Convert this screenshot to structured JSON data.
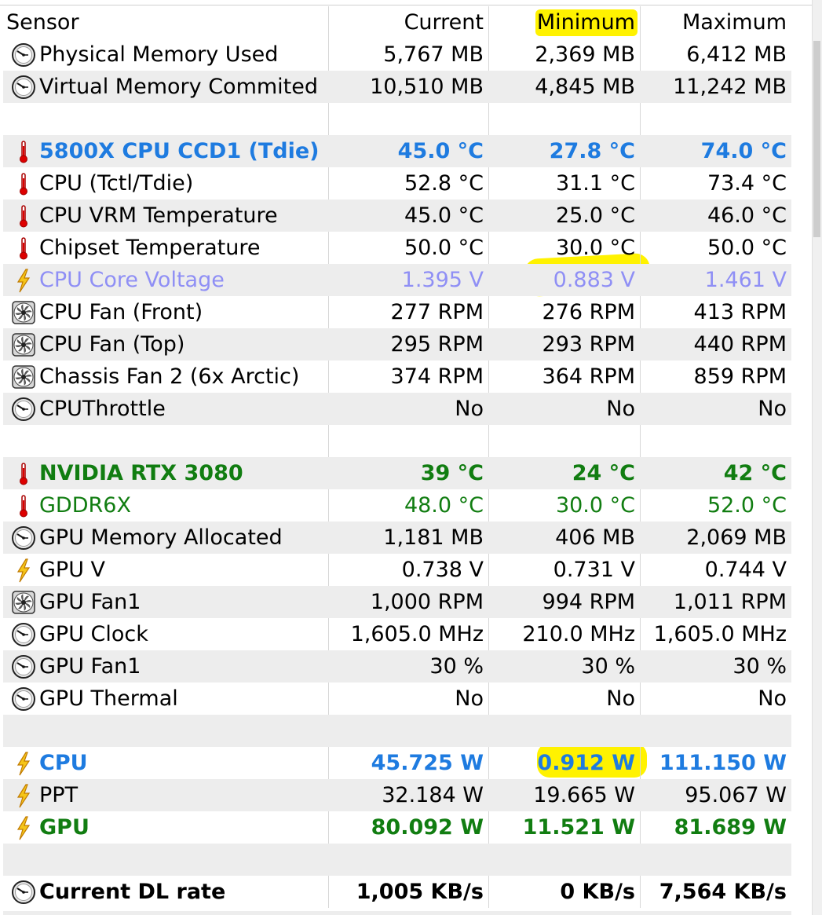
{
  "header": {
    "sensor": "Sensor",
    "current": "Current",
    "minimum": "Minimum",
    "maximum": "Maximum"
  },
  "colors": {
    "blue": "#1e7be0",
    "green": "#117d11",
    "faded": "#8f8ff5",
    "highlight": "#fff200"
  },
  "rows": [
    {
      "name": "Physical Memory Used",
      "cur": "5,767 MB",
      "min": "2,369 MB",
      "max": "6,412 MB",
      "icon": "clock-gauge-icon"
    },
    {
      "name": "Virtual Memory Commited",
      "cur": "10,510 MB",
      "min": "4,845 MB",
      "max": "11,242 MB",
      "icon": "clock-gauge-icon"
    },
    {
      "name": "",
      "cur": "",
      "min": "",
      "max": "",
      "icon": ""
    },
    {
      "name": "5800X CPU CCD1 (Tdie)",
      "cur": "45.0 °C",
      "min": "27.8 °C",
      "max": "74.0 °C",
      "icon": "thermometer-icon"
    },
    {
      "name": "CPU (Tctl/Tdie)",
      "cur": "52.8 °C",
      "min": "31.1 °C",
      "max": "73.4 °C",
      "icon": "thermometer-icon"
    },
    {
      "name": "CPU VRM Temperature",
      "cur": "45.0 °C",
      "min": "25.0 °C",
      "max": "46.0 °C",
      "icon": "thermometer-icon"
    },
    {
      "name": "Chipset Temperature",
      "cur": "50.0 °C",
      "min": "30.0 °C",
      "max": "50.0 °C",
      "icon": "thermometer-icon"
    },
    {
      "name": "CPU Core Voltage",
      "cur": "1.395 V",
      "min": "0.883 V",
      "max": "1.461 V",
      "icon": "lightning-icon"
    },
    {
      "name": "CPU Fan (Front)",
      "cur": "277 RPM",
      "min": "276 RPM",
      "max": "413 RPM",
      "icon": "fan-icon"
    },
    {
      "name": "CPU Fan (Top)",
      "cur": "295 RPM",
      "min": "293 RPM",
      "max": "440 RPM",
      "icon": "fan-icon"
    },
    {
      "name": "Chassis Fan 2 (6x Arctic)",
      "cur": "374 RPM",
      "min": "364 RPM",
      "max": "859 RPM",
      "icon": "fan-icon"
    },
    {
      "name": "CPUThrottle",
      "cur": "No",
      "min": "No",
      "max": "No",
      "icon": "clock-gauge-icon"
    },
    {
      "name": "",
      "cur": "",
      "min": "",
      "max": "",
      "icon": ""
    },
    {
      "name": "NVIDIA RTX 3080",
      "cur": "39 °C",
      "min": "24 °C",
      "max": "42 °C",
      "icon": "thermometer-icon"
    },
    {
      "name": "GDDR6X",
      "cur": "48.0 °C",
      "min": "30.0 °C",
      "max": "52.0 °C",
      "icon": "thermometer-icon"
    },
    {
      "name": "GPU Memory Allocated",
      "cur": "1,181 MB",
      "min": "406 MB",
      "max": "2,069 MB",
      "icon": "clock-gauge-icon"
    },
    {
      "name": "GPU V",
      "cur": "0.738 V",
      "min": "0.731 V",
      "max": "0.744 V",
      "icon": "lightning-icon"
    },
    {
      "name": "GPU Fan1",
      "cur": "1,000 RPM",
      "min": "994 RPM",
      "max": "1,011 RPM",
      "icon": "fan-icon"
    },
    {
      "name": "GPU Clock",
      "cur": "1,605.0 MHz",
      "min": "210.0 MHz",
      "max": "1,605.0 MHz",
      "icon": "clock-gauge-icon"
    },
    {
      "name": "GPU Fan1",
      "cur": "30 %",
      "min": "30 %",
      "max": "30 %",
      "icon": "clock-gauge-icon"
    },
    {
      "name": "GPU Thermal",
      "cur": "No",
      "min": "No",
      "max": "No",
      "icon": "clock-gauge-icon"
    },
    {
      "name": "",
      "cur": "",
      "min": "",
      "max": "",
      "icon": ""
    },
    {
      "name": "CPU",
      "cur": "45.725 W",
      "min": "0.912 W",
      "max": "111.150 W",
      "icon": "lightning-icon"
    },
    {
      "name": "PPT",
      "cur": "32.184 W",
      "min": "19.665 W",
      "max": "95.067 W",
      "icon": "lightning-icon"
    },
    {
      "name": "GPU",
      "cur": "80.092 W",
      "min": "11.521 W",
      "max": "81.689 W",
      "icon": "lightning-icon"
    },
    {
      "name": "",
      "cur": "",
      "min": "",
      "max": "",
      "icon": ""
    },
    {
      "name": "Current DL rate",
      "cur": "1,005 KB/s",
      "min": "0 KB/s",
      "max": "7,564 KB/s",
      "icon": "clock-gauge-icon"
    }
  ]
}
